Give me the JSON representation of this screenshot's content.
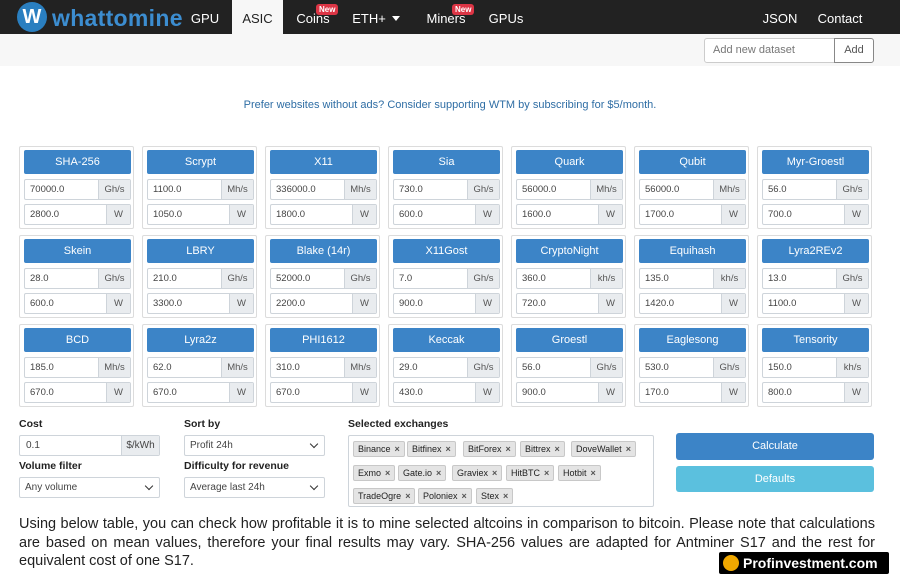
{
  "brand": {
    "logo_letter": "W",
    "name": "whattomine"
  },
  "nav": {
    "gpu": "GPU",
    "asic": "ASIC",
    "coins": "Coins",
    "coins_badge": "New",
    "eth": "ETH+",
    "miners": "Miners",
    "miners_badge": "New",
    "gpus": "GPUs",
    "json": "JSON",
    "contact": "Contact"
  },
  "dataset": {
    "placeholder": "Add new dataset",
    "add_label": "Add"
  },
  "promo": "Prefer websites without ads? Consider supporting WTM by subscribing for $5/month.",
  "algorithms": [
    {
      "name": "SHA-256",
      "hashrate": "70000.0",
      "hash_unit": "Gh/s",
      "power": "2800.0",
      "power_unit": "W"
    },
    {
      "name": "Scrypt",
      "hashrate": "1100.0",
      "hash_unit": "Mh/s",
      "power": "1050.0",
      "power_unit": "W"
    },
    {
      "name": "X11",
      "hashrate": "336000.0",
      "hash_unit": "Mh/s",
      "power": "1800.0",
      "power_unit": "W"
    },
    {
      "name": "Sia",
      "hashrate": "730.0",
      "hash_unit": "Gh/s",
      "power": "600.0",
      "power_unit": "W"
    },
    {
      "name": "Quark",
      "hashrate": "56000.0",
      "hash_unit": "Mh/s",
      "power": "1600.0",
      "power_unit": "W"
    },
    {
      "name": "Qubit",
      "hashrate": "56000.0",
      "hash_unit": "Mh/s",
      "power": "1700.0",
      "power_unit": "W"
    },
    {
      "name": "Myr-Groestl",
      "hashrate": "56.0",
      "hash_unit": "Gh/s",
      "power": "700.0",
      "power_unit": "W"
    },
    {
      "name": "Skein",
      "hashrate": "28.0",
      "hash_unit": "Gh/s",
      "power": "600.0",
      "power_unit": "W"
    },
    {
      "name": "LBRY",
      "hashrate": "210.0",
      "hash_unit": "Gh/s",
      "power": "3300.0",
      "power_unit": "W"
    },
    {
      "name": "Blake (14r)",
      "hashrate": "52000.0",
      "hash_unit": "Gh/s",
      "power": "2200.0",
      "power_unit": "W"
    },
    {
      "name": "X11Gost",
      "hashrate": "7.0",
      "hash_unit": "Gh/s",
      "power": "900.0",
      "power_unit": "W"
    },
    {
      "name": "CryptoNight",
      "hashrate": "360.0",
      "hash_unit": "kh/s",
      "power": "720.0",
      "power_unit": "W"
    },
    {
      "name": "Equihash",
      "hashrate": "135.0",
      "hash_unit": "kh/s",
      "power": "1420.0",
      "power_unit": "W"
    },
    {
      "name": "Lyra2REv2",
      "hashrate": "13.0",
      "hash_unit": "Gh/s",
      "power": "1100.0",
      "power_unit": "W"
    },
    {
      "name": "BCD",
      "hashrate": "185.0",
      "hash_unit": "Mh/s",
      "power": "670.0",
      "power_unit": "W"
    },
    {
      "name": "Lyra2z",
      "hashrate": "62.0",
      "hash_unit": "Mh/s",
      "power": "670.0",
      "power_unit": "W"
    },
    {
      "name": "PHI1612",
      "hashrate": "310.0",
      "hash_unit": "Mh/s",
      "power": "670.0",
      "power_unit": "W"
    },
    {
      "name": "Keccak",
      "hashrate": "29.0",
      "hash_unit": "Gh/s",
      "power": "430.0",
      "power_unit": "W"
    },
    {
      "name": "Groestl",
      "hashrate": "56.0",
      "hash_unit": "Gh/s",
      "power": "900.0",
      "power_unit": "W"
    },
    {
      "name": "Eaglesong",
      "hashrate": "530.0",
      "hash_unit": "Gh/s",
      "power": "170.0",
      "power_unit": "W"
    },
    {
      "name": "Tensority",
      "hashrate": "150.0",
      "hash_unit": "kh/s",
      "power": "800.0",
      "power_unit": "W"
    }
  ],
  "form": {
    "cost_label": "Cost",
    "cost_value": "0.1",
    "cost_unit": "$/kWh",
    "volume_label": "Volume filter",
    "volume_value": "Any volume",
    "sort_label": "Sort by",
    "sort_value": "Profit 24h",
    "difficulty_label": "Difficulty for revenue",
    "difficulty_value": "Average last 24h",
    "exchanges_label": "Selected exchanges",
    "exchanges": [
      "Binance",
      "Bitfinex",
      "BitForex",
      "Bittrex",
      "DoveWallet",
      "Exmo",
      "Gate.io",
      "Graviex",
      "HitBTC",
      "Hotbit",
      "TradeOgre",
      "Poloniex",
      "Stex"
    ],
    "remove_glyph": "×",
    "calculate_label": "Calculate",
    "defaults_label": "Defaults"
  },
  "description": "Using below table, you can check how profitable it is to mine selected altcoins in comparison to bitcoin. Please note that calculations are based on mean values, therefore your final results may vary. SHA-256 values are adapted for Antminer S17 and the rest for equivalent cost of one S17.",
  "watermark": "Profinvestment.com",
  "colors": {
    "nav_bg": "#222222",
    "primary": "#3c84c7",
    "info": "#5bc0de",
    "badge": "#dc3545"
  }
}
